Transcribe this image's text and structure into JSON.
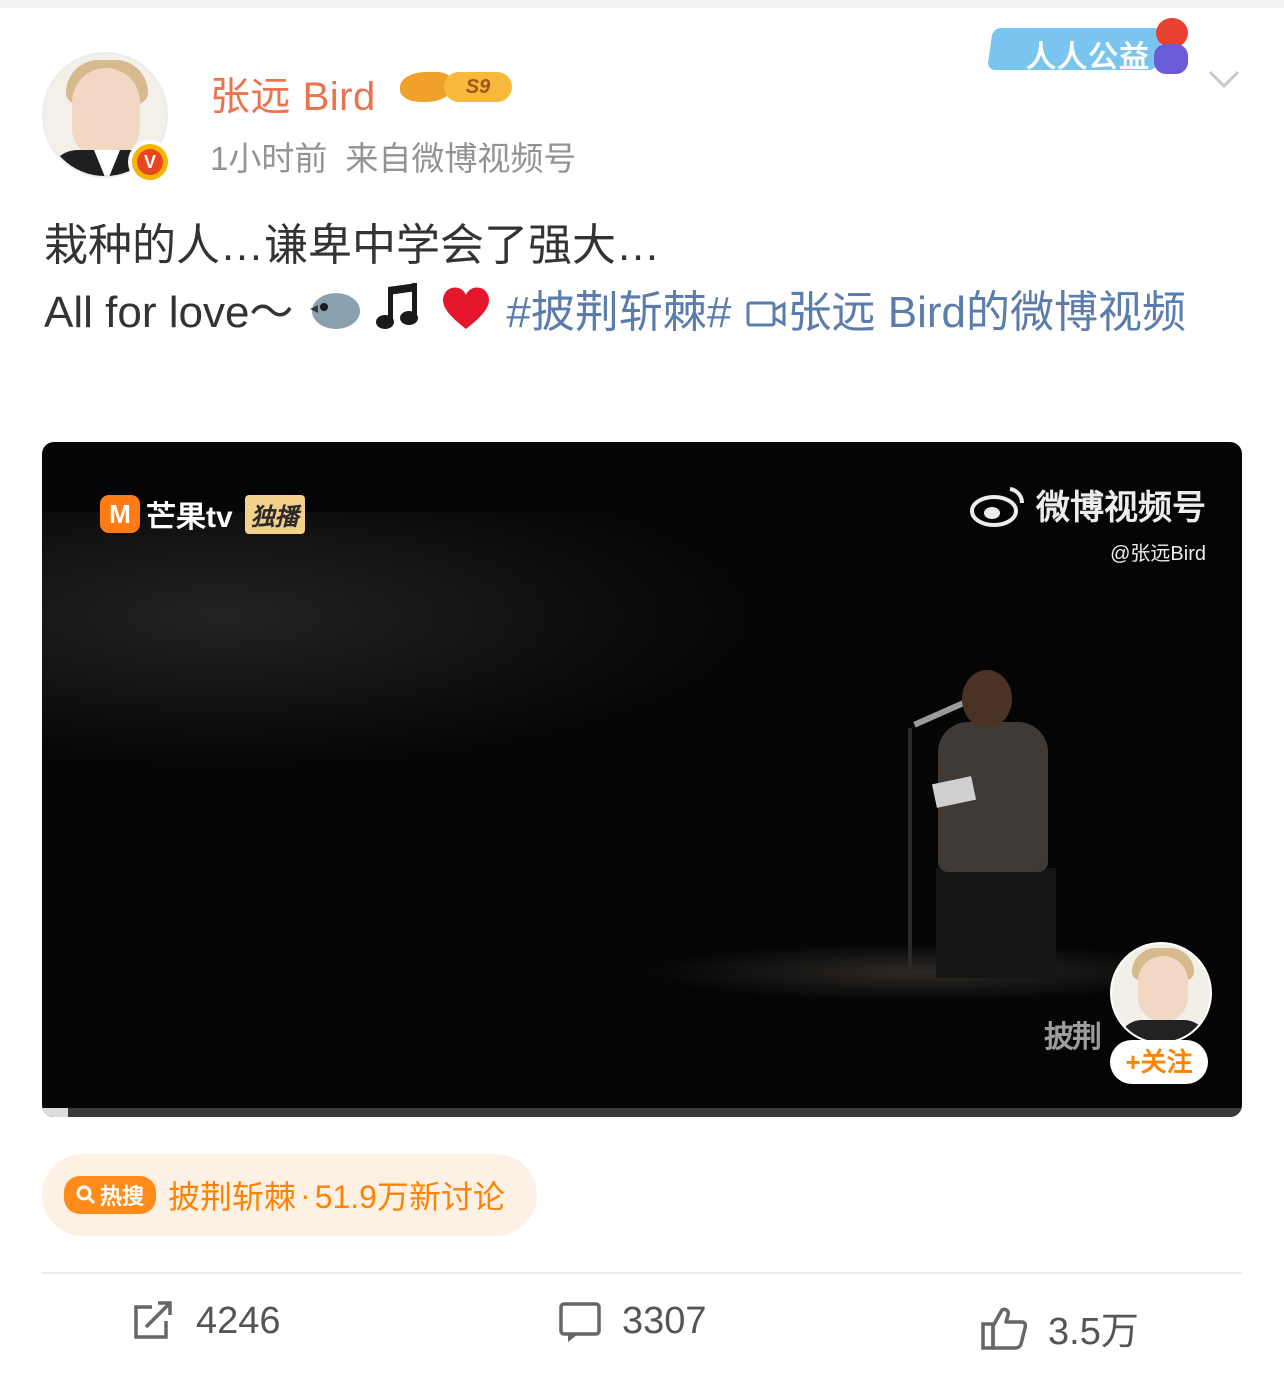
{
  "post": {
    "author": {
      "name": "张远 Bird",
      "level_badge": "S9",
      "verified_icon": "v-badge-icon"
    },
    "meta": {
      "time": "1小时前",
      "source": "来自微博视频号"
    },
    "promo_banner": "人人公益",
    "content": {
      "line1": "栽种的人…谦卑中学会了强大…",
      "line2_prefix": "All for love～",
      "emojis": [
        "bird-emoji",
        "music-note-emoji",
        "red-heart-emoji"
      ],
      "hashtag": "#披荆斩棘#",
      "video_link": "张远 Bird的微博视频"
    },
    "video": {
      "broadcaster": "芒果tv",
      "broadcaster_logo": "M",
      "exclusive": "独播",
      "watermark_title": "微博视频号",
      "watermark_handle": "@张远Bird",
      "show_logo": "披荆",
      "follow_button": "+关注",
      "progress": 0.022
    },
    "hot_search": {
      "tag": "热搜",
      "topic": "披荆斩棘",
      "count": "51.9万新讨论"
    },
    "actions": {
      "repost_count": "4246",
      "comment_count": "3307",
      "like_count": "3.5万"
    }
  },
  "colors": {
    "username": "#eb7350",
    "link": "#5a7dad",
    "hot": "#ff8200",
    "meta": "#939393"
  }
}
